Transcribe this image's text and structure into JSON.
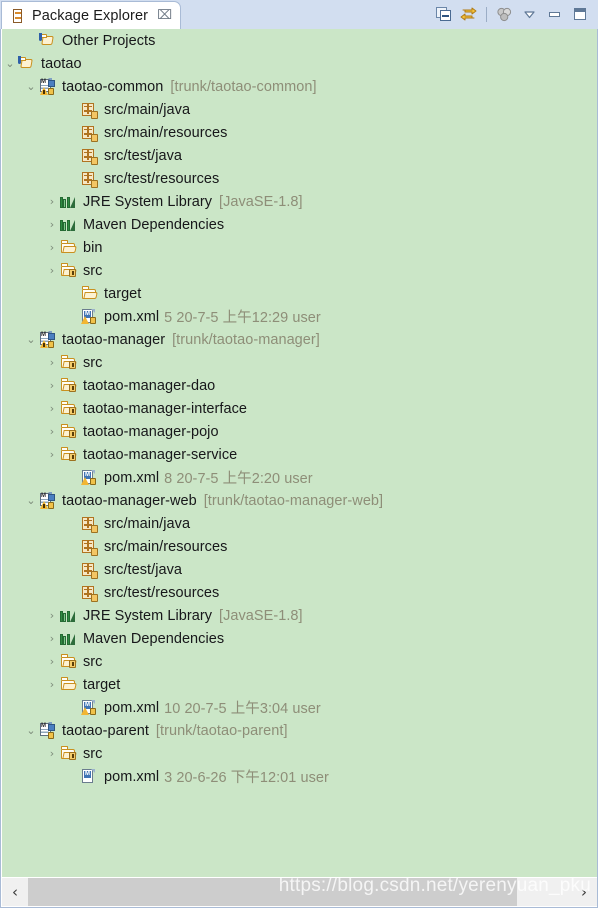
{
  "view": {
    "tab_title": "Package Explorer",
    "tab_icon": "package-explorer-icon",
    "close_glyph": "⌧"
  },
  "toolbar": {
    "buttons": [
      {
        "name": "collapse-all-button",
        "tooltip": "Collapse All"
      },
      {
        "name": "link-with-editor-button",
        "tooltip": "Link with Editor"
      },
      {
        "name": "view-filters-button",
        "tooltip": "Filters"
      },
      {
        "name": "view-menu-button",
        "glyph": "▽"
      },
      {
        "name": "minimize-button",
        "tooltip": "Minimize"
      },
      {
        "name": "maximize-button",
        "tooltip": "Maximize"
      }
    ]
  },
  "colors": {
    "tree_background": "#cbe6c7",
    "tab_bar": "#d2def0",
    "panel_border": "#a9bbd6",
    "label_text": "#17171a",
    "meta_text": "#8e8e78"
  },
  "tree": {
    "rows": [
      {
        "indent": 1,
        "twisty": "",
        "icon": "working-set-icon",
        "label": "Other Projects",
        "meta": ""
      },
      {
        "indent": 0,
        "twisty": "⌄",
        "icon": "working-set-icon",
        "label": "taotao",
        "meta": ""
      },
      {
        "indent": 1,
        "twisty": "⌄",
        "icon": "maven-project-icon",
        "label": "taotao-common",
        "meta": "[trunk/taotao-common]"
      },
      {
        "indent": 3,
        "twisty": "",
        "icon": "source-package-icon",
        "label": "src/main/java",
        "meta": ""
      },
      {
        "indent": 3,
        "twisty": "",
        "icon": "source-package-icon",
        "label": "src/main/resources",
        "meta": ""
      },
      {
        "indent": 3,
        "twisty": "",
        "icon": "source-package-icon",
        "label": "src/test/java",
        "meta": ""
      },
      {
        "indent": 3,
        "twisty": "",
        "icon": "source-package-icon",
        "label": "src/test/resources",
        "meta": ""
      },
      {
        "indent": 2,
        "twisty": "›",
        "icon": "library-icon",
        "label": "JRE System Library",
        "meta": "[JavaSE-1.8]"
      },
      {
        "indent": 2,
        "twisty": "›",
        "icon": "library-icon",
        "label": "Maven Dependencies",
        "meta": ""
      },
      {
        "indent": 2,
        "twisty": "›",
        "icon": "folder-icon",
        "label": "bin",
        "meta": ""
      },
      {
        "indent": 2,
        "twisty": "›",
        "icon": "source-folder-icon",
        "label": "src",
        "meta": ""
      },
      {
        "indent": 3,
        "twisty": "",
        "icon": "folder-icon",
        "label": "target",
        "meta": ""
      },
      {
        "indent": 3,
        "twisty": "",
        "icon": "xml-file-icon",
        "label": "pom.xml",
        "meta": "5  20-7-5 上午12:29  user"
      },
      {
        "indent": 1,
        "twisty": "⌄",
        "icon": "maven-project-icon",
        "label": "taotao-manager",
        "meta": "[trunk/taotao-manager]"
      },
      {
        "indent": 2,
        "twisty": "›",
        "icon": "source-folder-icon",
        "label": "src",
        "meta": ""
      },
      {
        "indent": 2,
        "twisty": "›",
        "icon": "source-folder-icon",
        "label": "taotao-manager-dao",
        "meta": ""
      },
      {
        "indent": 2,
        "twisty": "›",
        "icon": "source-folder-icon",
        "label": "taotao-manager-interface",
        "meta": ""
      },
      {
        "indent": 2,
        "twisty": "›",
        "icon": "source-folder-icon",
        "label": "taotao-manager-pojo",
        "meta": ""
      },
      {
        "indent": 2,
        "twisty": "›",
        "icon": "source-folder-icon",
        "label": "taotao-manager-service",
        "meta": ""
      },
      {
        "indent": 3,
        "twisty": "",
        "icon": "xml-file-icon",
        "label": "pom.xml",
        "meta": "8  20-7-5 上午2:20  user"
      },
      {
        "indent": 1,
        "twisty": "⌄",
        "icon": "maven-project-icon",
        "label": "taotao-manager-web",
        "meta": "[trunk/taotao-manager-web]"
      },
      {
        "indent": 3,
        "twisty": "",
        "icon": "source-package-icon",
        "label": "src/main/java",
        "meta": ""
      },
      {
        "indent": 3,
        "twisty": "",
        "icon": "source-package-icon",
        "label": "src/main/resources",
        "meta": ""
      },
      {
        "indent": 3,
        "twisty": "",
        "icon": "source-package-icon",
        "label": "src/test/java",
        "meta": ""
      },
      {
        "indent": 3,
        "twisty": "",
        "icon": "source-package-icon",
        "label": "src/test/resources",
        "meta": ""
      },
      {
        "indent": 2,
        "twisty": "›",
        "icon": "library-icon",
        "label": "JRE System Library",
        "meta": "[JavaSE-1.8]"
      },
      {
        "indent": 2,
        "twisty": "›",
        "icon": "library-icon",
        "label": "Maven Dependencies",
        "meta": ""
      },
      {
        "indent": 2,
        "twisty": "›",
        "icon": "source-folder-icon",
        "label": "src",
        "meta": ""
      },
      {
        "indent": 2,
        "twisty": "›",
        "icon": "folder-icon",
        "label": "target",
        "meta": ""
      },
      {
        "indent": 3,
        "twisty": "",
        "icon": "xml-file-icon",
        "label": "pom.xml",
        "meta": "10  20-7-5 上午3:04  user"
      },
      {
        "indent": 1,
        "twisty": "⌄",
        "icon": "maven-project-plain-icon",
        "label": "taotao-parent",
        "meta": "[trunk/taotao-parent]"
      },
      {
        "indent": 2,
        "twisty": "›",
        "icon": "source-folder-icon",
        "label": "src",
        "meta": ""
      },
      {
        "indent": 3,
        "twisty": "",
        "icon": "xml-file-plain-icon",
        "label": "pom.xml",
        "meta": "3  20-6-26 下午12:01  user"
      }
    ]
  },
  "scrollbar": {
    "left_arrow": "‹",
    "right_arrow": "›",
    "thumb_percent": 90
  },
  "watermark": {
    "text": "https://blog.csdn.net/yerenyuan_pku"
  }
}
